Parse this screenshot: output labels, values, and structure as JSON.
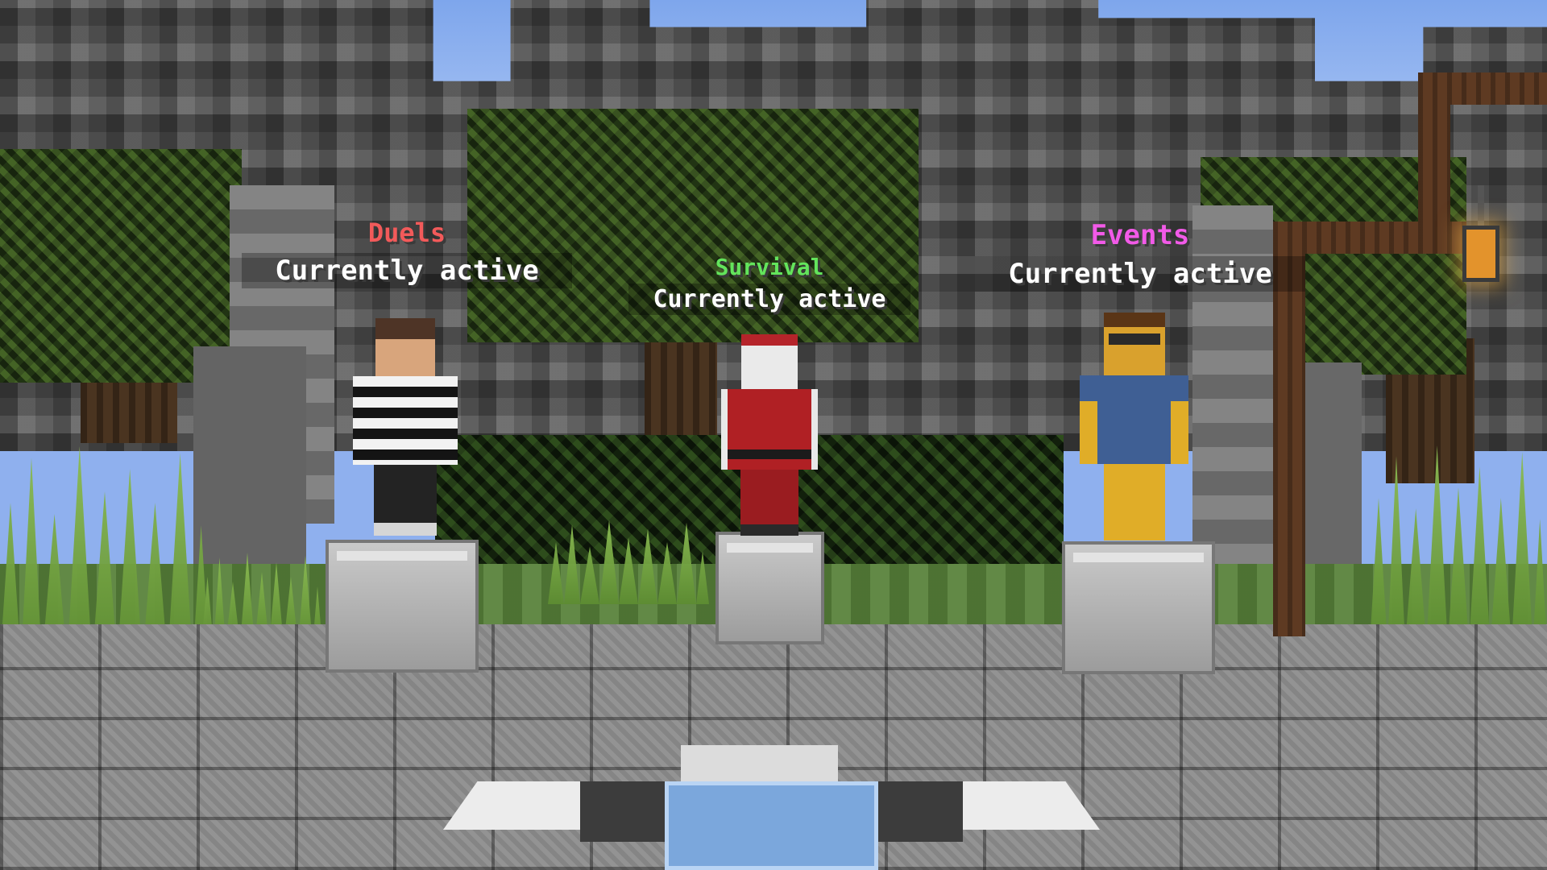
{
  "npcs": [
    {
      "mode": "Duels",
      "status": "Currently active",
      "color": "#f25a5a"
    },
    {
      "mode": "Survival",
      "status": "Currently active",
      "color": "#63e45c"
    },
    {
      "mode": "Events",
      "status": "Currently active",
      "color": "#f25ae8"
    }
  ]
}
